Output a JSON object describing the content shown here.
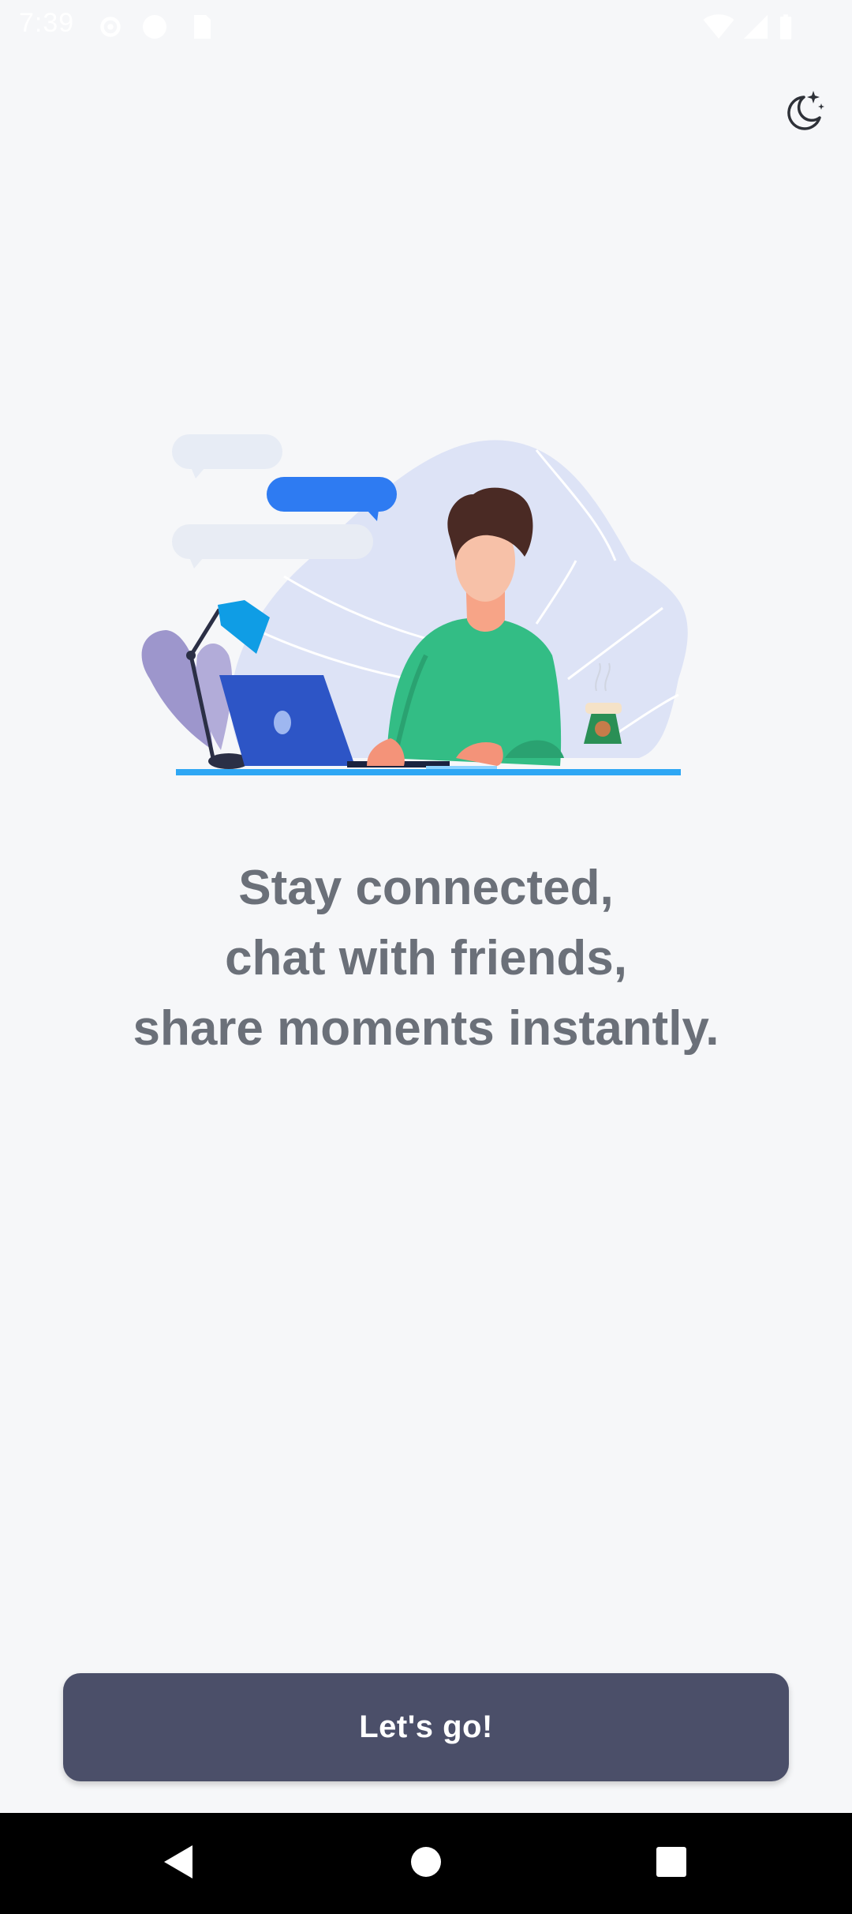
{
  "status_bar": {
    "time": "7:39",
    "icons": [
      "gear-icon",
      "alert-circle-icon",
      "sd-card-icon",
      "wifi-icon",
      "signal-icon",
      "battery-icon"
    ]
  },
  "header": {
    "theme_toggle_icon": "moon-stars-icon"
  },
  "illustration": {
    "icon": "person-at-laptop-illustration"
  },
  "tagline": {
    "line1": "Stay connected,",
    "line2": "chat with friends,",
    "line3": "share moments instantly."
  },
  "cta": {
    "label": "Let's go!"
  },
  "nav_bar": {
    "icons": [
      "back-icon",
      "home-icon",
      "recents-icon"
    ]
  },
  "colors": {
    "background": "#f6f7f9",
    "text": "#6b7079",
    "button": "#4b4f69",
    "button_text": "#ffffff"
  }
}
